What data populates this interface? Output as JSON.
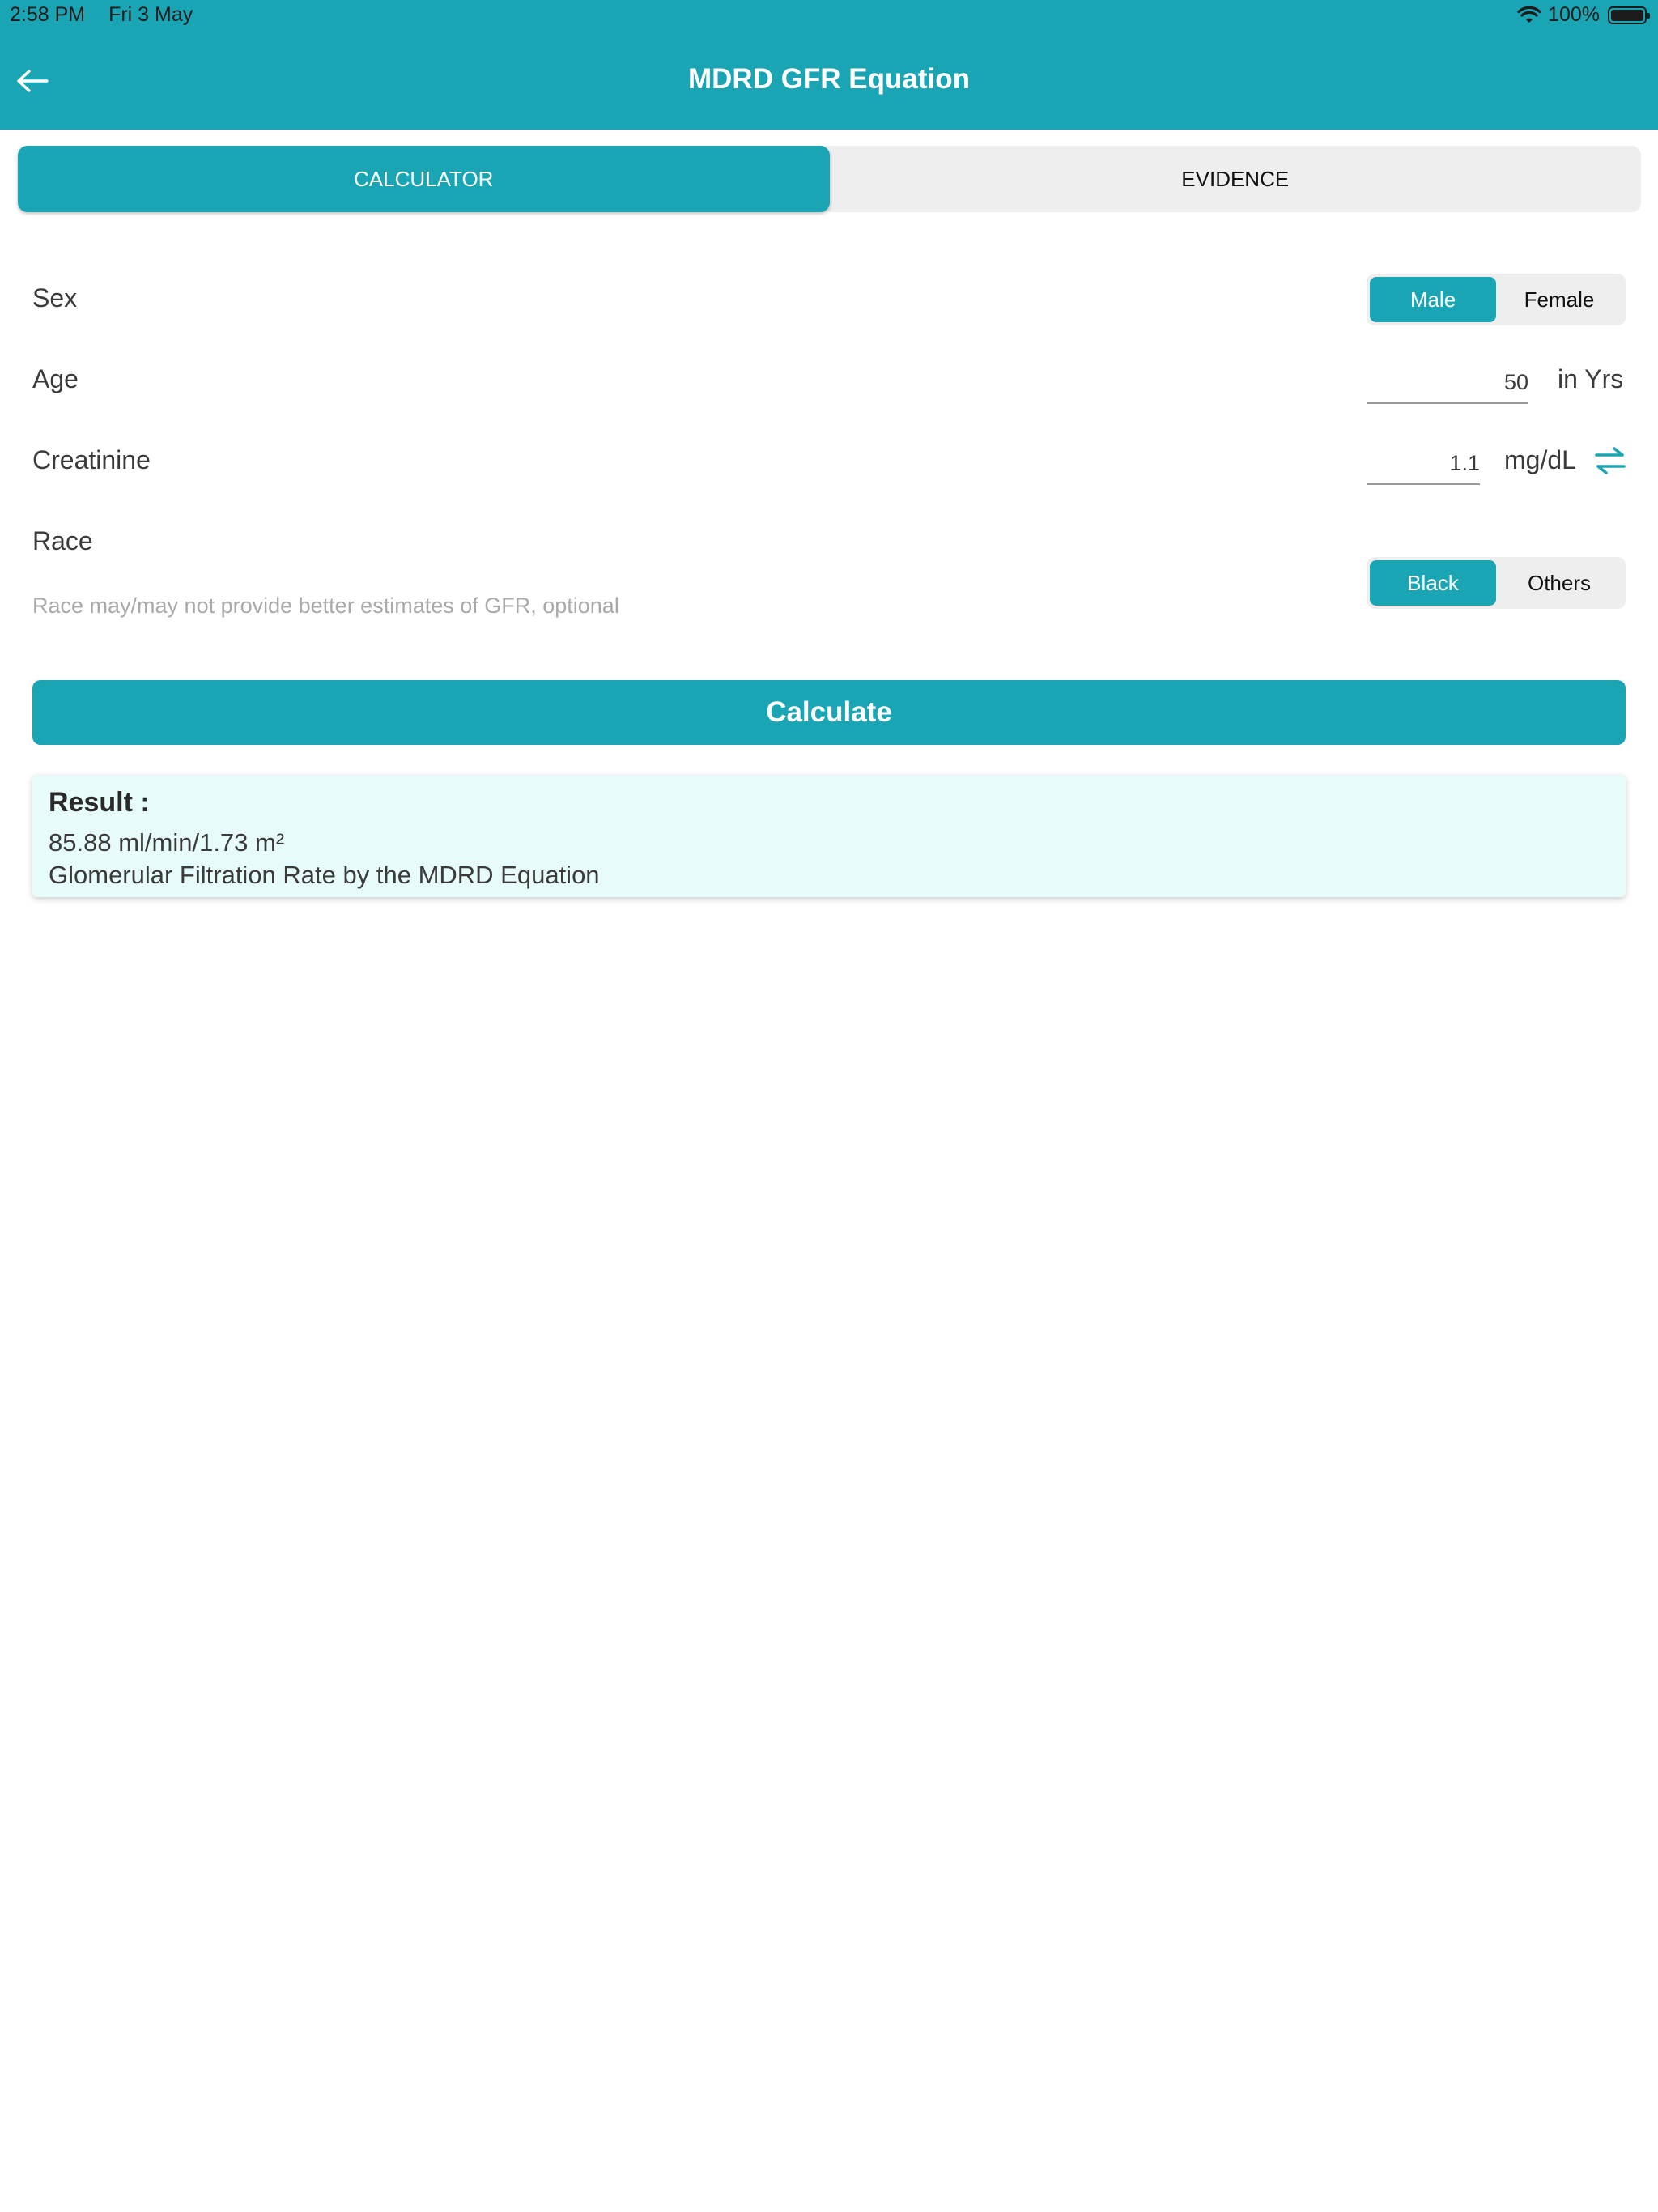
{
  "status_bar": {
    "time": "2:58 PM",
    "date": "Fri 3 May",
    "battery": "100%"
  },
  "header": {
    "title": "MDRD GFR Equation"
  },
  "tabs": [
    {
      "label": "CALCULATOR",
      "active": true
    },
    {
      "label": "EVIDENCE",
      "active": false
    }
  ],
  "form": {
    "sex": {
      "label": "Sex",
      "options": [
        "Male",
        "Female"
      ],
      "selected": "Male"
    },
    "age": {
      "label": "Age",
      "value": "50",
      "unit": "in Yrs"
    },
    "creatinine": {
      "label": "Creatinine",
      "value": "1.1",
      "unit": "mg/dL"
    },
    "race": {
      "label": "Race",
      "hint": "Race may/may not provide better estimates of GFR, optional",
      "options": [
        "Black",
        "Others"
      ],
      "selected": "Black"
    }
  },
  "calculate_label": "Calculate",
  "result": {
    "title": "Result :",
    "value": "85.88 ml/min/1.73 m²",
    "description": "Glomerular Filtration Rate by the MDRD Equation"
  },
  "colors": {
    "accent": "#1aa5b4",
    "result_bg": "#e8fbfb"
  }
}
